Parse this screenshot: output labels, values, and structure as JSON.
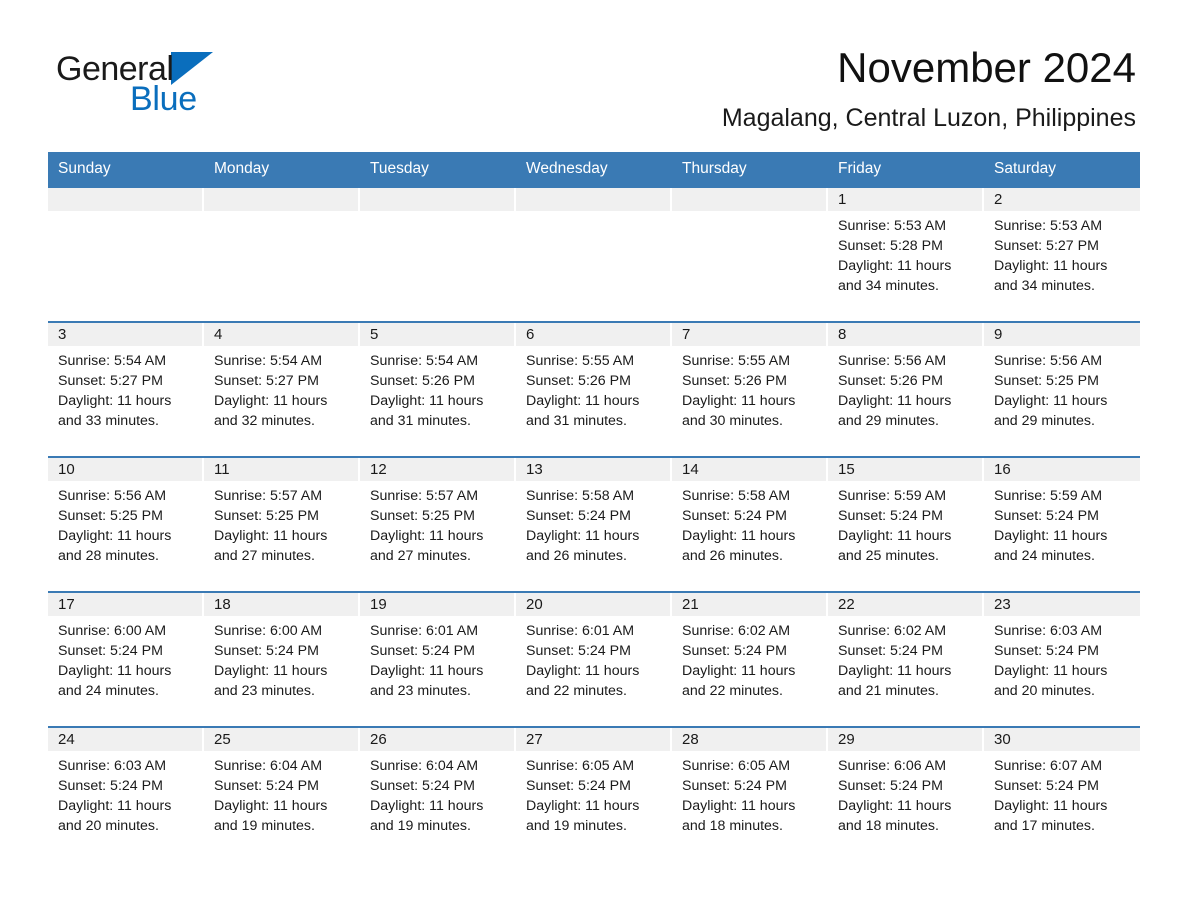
{
  "logo": {
    "word1": "General",
    "word2": "Blue",
    "triangle_color": "#0a6ebd",
    "icon": "triangle-icon"
  },
  "header": {
    "month_title": "November 2024",
    "location": "Magalang, Central Luzon, Philippines"
  },
  "theme": {
    "header_blue": "#3a7ab4",
    "band_gray": "#f0f0f0",
    "text": "#1a1a1a"
  },
  "calendar": {
    "weekdays": [
      "Sunday",
      "Monday",
      "Tuesday",
      "Wednesday",
      "Thursday",
      "Friday",
      "Saturday"
    ],
    "weeks": [
      [
        {
          "day": "",
          "empty": true
        },
        {
          "day": "",
          "empty": true
        },
        {
          "day": "",
          "empty": true
        },
        {
          "day": "",
          "empty": true
        },
        {
          "day": "",
          "empty": true
        },
        {
          "day": "1",
          "sunrise": "Sunrise: 5:53 AM",
          "sunset": "Sunset: 5:28 PM",
          "daylight1": "Daylight: 11 hours",
          "daylight2": "and 34 minutes."
        },
        {
          "day": "2",
          "sunrise": "Sunrise: 5:53 AM",
          "sunset": "Sunset: 5:27 PM",
          "daylight1": "Daylight: 11 hours",
          "daylight2": "and 34 minutes."
        }
      ],
      [
        {
          "day": "3",
          "sunrise": "Sunrise: 5:54 AM",
          "sunset": "Sunset: 5:27 PM",
          "daylight1": "Daylight: 11 hours",
          "daylight2": "and 33 minutes."
        },
        {
          "day": "4",
          "sunrise": "Sunrise: 5:54 AM",
          "sunset": "Sunset: 5:27 PM",
          "daylight1": "Daylight: 11 hours",
          "daylight2": "and 32 minutes."
        },
        {
          "day": "5",
          "sunrise": "Sunrise: 5:54 AM",
          "sunset": "Sunset: 5:26 PM",
          "daylight1": "Daylight: 11 hours",
          "daylight2": "and 31 minutes."
        },
        {
          "day": "6",
          "sunrise": "Sunrise: 5:55 AM",
          "sunset": "Sunset: 5:26 PM",
          "daylight1": "Daylight: 11 hours",
          "daylight2": "and 31 minutes."
        },
        {
          "day": "7",
          "sunrise": "Sunrise: 5:55 AM",
          "sunset": "Sunset: 5:26 PM",
          "daylight1": "Daylight: 11 hours",
          "daylight2": "and 30 minutes."
        },
        {
          "day": "8",
          "sunrise": "Sunrise: 5:56 AM",
          "sunset": "Sunset: 5:26 PM",
          "daylight1": "Daylight: 11 hours",
          "daylight2": "and 29 minutes."
        },
        {
          "day": "9",
          "sunrise": "Sunrise: 5:56 AM",
          "sunset": "Sunset: 5:25 PM",
          "daylight1": "Daylight: 11 hours",
          "daylight2": "and 29 minutes."
        }
      ],
      [
        {
          "day": "10",
          "sunrise": "Sunrise: 5:56 AM",
          "sunset": "Sunset: 5:25 PM",
          "daylight1": "Daylight: 11 hours",
          "daylight2": "and 28 minutes."
        },
        {
          "day": "11",
          "sunrise": "Sunrise: 5:57 AM",
          "sunset": "Sunset: 5:25 PM",
          "daylight1": "Daylight: 11 hours",
          "daylight2": "and 27 minutes."
        },
        {
          "day": "12",
          "sunrise": "Sunrise: 5:57 AM",
          "sunset": "Sunset: 5:25 PM",
          "daylight1": "Daylight: 11 hours",
          "daylight2": "and 27 minutes."
        },
        {
          "day": "13",
          "sunrise": "Sunrise: 5:58 AM",
          "sunset": "Sunset: 5:24 PM",
          "daylight1": "Daylight: 11 hours",
          "daylight2": "and 26 minutes."
        },
        {
          "day": "14",
          "sunrise": "Sunrise: 5:58 AM",
          "sunset": "Sunset: 5:24 PM",
          "daylight1": "Daylight: 11 hours",
          "daylight2": "and 26 minutes."
        },
        {
          "day": "15",
          "sunrise": "Sunrise: 5:59 AM",
          "sunset": "Sunset: 5:24 PM",
          "daylight1": "Daylight: 11 hours",
          "daylight2": "and 25 minutes."
        },
        {
          "day": "16",
          "sunrise": "Sunrise: 5:59 AM",
          "sunset": "Sunset: 5:24 PM",
          "daylight1": "Daylight: 11 hours",
          "daylight2": "and 24 minutes."
        }
      ],
      [
        {
          "day": "17",
          "sunrise": "Sunrise: 6:00 AM",
          "sunset": "Sunset: 5:24 PM",
          "daylight1": "Daylight: 11 hours",
          "daylight2": "and 24 minutes."
        },
        {
          "day": "18",
          "sunrise": "Sunrise: 6:00 AM",
          "sunset": "Sunset: 5:24 PM",
          "daylight1": "Daylight: 11 hours",
          "daylight2": "and 23 minutes."
        },
        {
          "day": "19",
          "sunrise": "Sunrise: 6:01 AM",
          "sunset": "Sunset: 5:24 PM",
          "daylight1": "Daylight: 11 hours",
          "daylight2": "and 23 minutes."
        },
        {
          "day": "20",
          "sunrise": "Sunrise: 6:01 AM",
          "sunset": "Sunset: 5:24 PM",
          "daylight1": "Daylight: 11 hours",
          "daylight2": "and 22 minutes."
        },
        {
          "day": "21",
          "sunrise": "Sunrise: 6:02 AM",
          "sunset": "Sunset: 5:24 PM",
          "daylight1": "Daylight: 11 hours",
          "daylight2": "and 22 minutes."
        },
        {
          "day": "22",
          "sunrise": "Sunrise: 6:02 AM",
          "sunset": "Sunset: 5:24 PM",
          "daylight1": "Daylight: 11 hours",
          "daylight2": "and 21 minutes."
        },
        {
          "day": "23",
          "sunrise": "Sunrise: 6:03 AM",
          "sunset": "Sunset: 5:24 PM",
          "daylight1": "Daylight: 11 hours",
          "daylight2": "and 20 minutes."
        }
      ],
      [
        {
          "day": "24",
          "sunrise": "Sunrise: 6:03 AM",
          "sunset": "Sunset: 5:24 PM",
          "daylight1": "Daylight: 11 hours",
          "daylight2": "and 20 minutes."
        },
        {
          "day": "25",
          "sunrise": "Sunrise: 6:04 AM",
          "sunset": "Sunset: 5:24 PM",
          "daylight1": "Daylight: 11 hours",
          "daylight2": "and 19 minutes."
        },
        {
          "day": "26",
          "sunrise": "Sunrise: 6:04 AM",
          "sunset": "Sunset: 5:24 PM",
          "daylight1": "Daylight: 11 hours",
          "daylight2": "and 19 minutes."
        },
        {
          "day": "27",
          "sunrise": "Sunrise: 6:05 AM",
          "sunset": "Sunset: 5:24 PM",
          "daylight1": "Daylight: 11 hours",
          "daylight2": "and 19 minutes."
        },
        {
          "day": "28",
          "sunrise": "Sunrise: 6:05 AM",
          "sunset": "Sunset: 5:24 PM",
          "daylight1": "Daylight: 11 hours",
          "daylight2": "and 18 minutes."
        },
        {
          "day": "29",
          "sunrise": "Sunrise: 6:06 AM",
          "sunset": "Sunset: 5:24 PM",
          "daylight1": "Daylight: 11 hours",
          "daylight2": "and 18 minutes."
        },
        {
          "day": "30",
          "sunrise": "Sunrise: 6:07 AM",
          "sunset": "Sunset: 5:24 PM",
          "daylight1": "Daylight: 11 hours",
          "daylight2": "and 17 minutes."
        }
      ]
    ]
  }
}
